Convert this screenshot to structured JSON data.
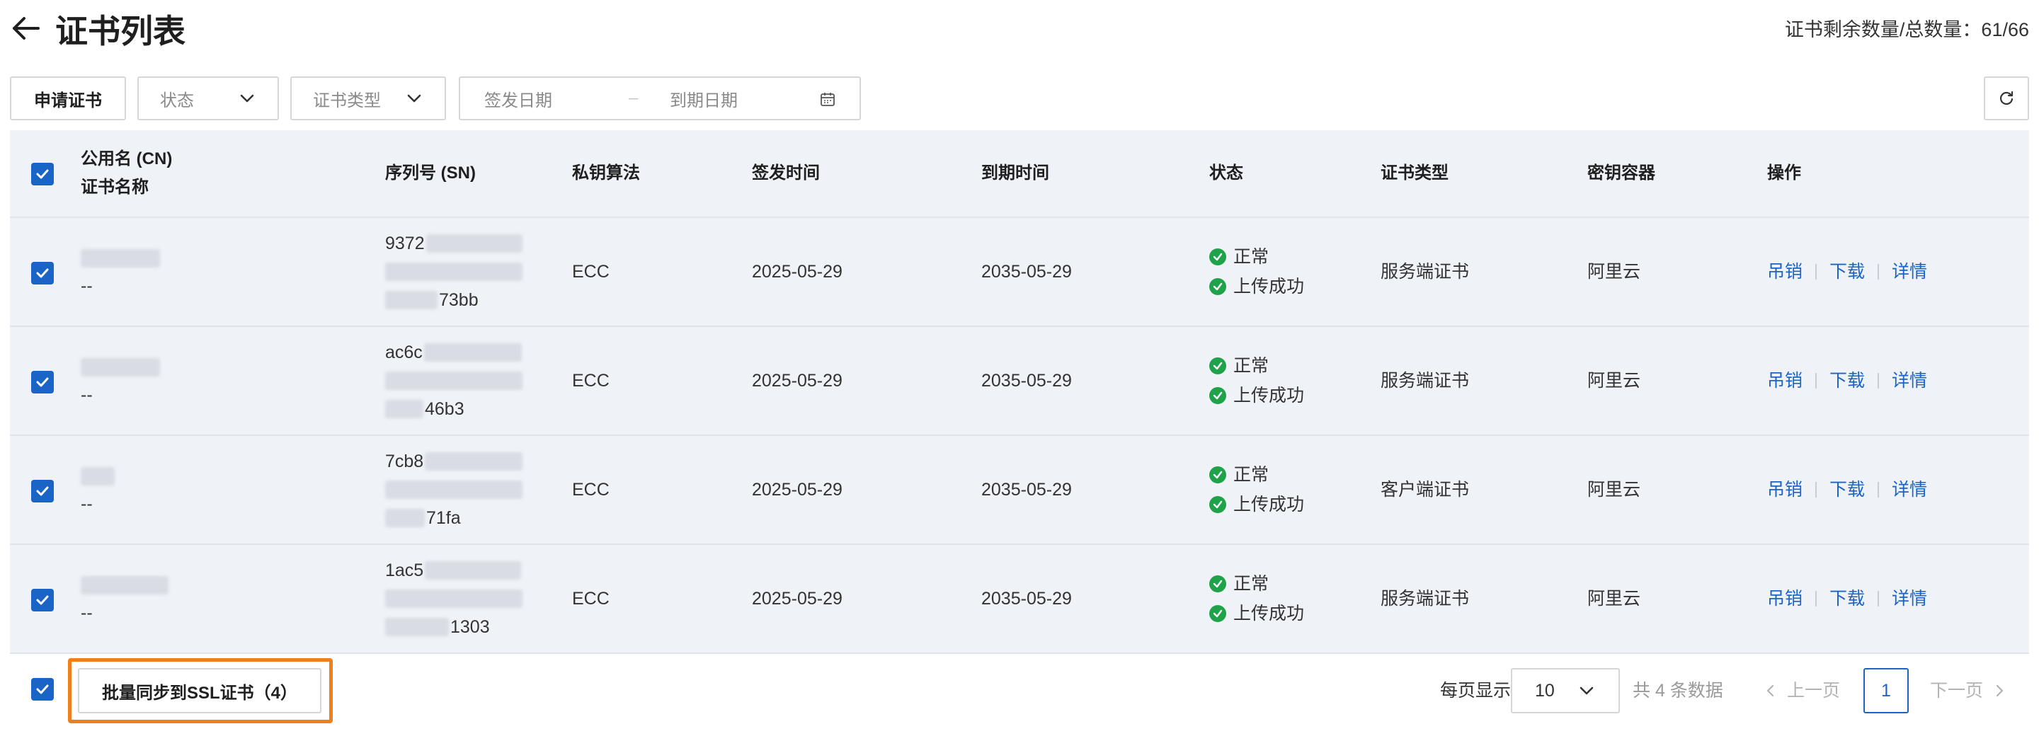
{
  "header": {
    "title": "证书列表",
    "quota_label": "证书剩余数量/总数量：",
    "quota_value": "61/66"
  },
  "toolbar": {
    "apply_label": "申请证书",
    "status_placeholder": "状态",
    "type_placeholder": "证书类型",
    "date_start_placeholder": "签发日期",
    "date_separator": "–",
    "date_end_placeholder": "到期日期"
  },
  "table": {
    "columns": {
      "cn": "公用名 (CN)",
      "cert_name": "证书名称",
      "sn": "序列号 (SN)",
      "algo": "私钥算法",
      "issue": "签发时间",
      "expire": "到期时间",
      "status": "状态",
      "type": "证书类型",
      "container": "密钥容器",
      "actions": "操作"
    },
    "rows": [
      {
        "cert_name": "--",
        "sn_start": "9372",
        "sn_end": "73bb",
        "algo": "ECC",
        "issue": "2025-05-29",
        "expire": "2035-05-29",
        "status1": "正常",
        "status2": "上传成功",
        "type": "服务端证书",
        "container": "阿里云",
        "act_revoke": "吊销",
        "act_download": "下载",
        "act_detail": "详情"
      },
      {
        "cert_name": "--",
        "sn_start": "ac6c",
        "sn_end": "46b3",
        "algo": "ECC",
        "issue": "2025-05-29",
        "expire": "2035-05-29",
        "status1": "正常",
        "status2": "上传成功",
        "type": "服务端证书",
        "container": "阿里云",
        "act_revoke": "吊销",
        "act_download": "下载",
        "act_detail": "详情"
      },
      {
        "cert_name": "--",
        "sn_start": "7cb8",
        "sn_end": "71fa",
        "algo": "ECC",
        "issue": "2025-05-29",
        "expire": "2035-05-29",
        "status1": "正常",
        "status2": "上传成功",
        "type": "客户端证书",
        "container": "阿里云",
        "act_revoke": "吊销",
        "act_download": "下载",
        "act_detail": "详情"
      },
      {
        "cert_name": "--",
        "sn_start": "1ac5",
        "sn_end": "1303",
        "algo": "ECC",
        "issue": "2025-05-29",
        "expire": "2035-05-29",
        "status1": "正常",
        "status2": "上传成功",
        "type": "服务端证书",
        "container": "阿里云",
        "act_revoke": "吊销",
        "act_download": "下载",
        "act_detail": "详情"
      }
    ]
  },
  "footer": {
    "batch_label": "批量同步到SSL证书（4）",
    "per_page_label": "每页显示",
    "page_size": "10",
    "total_text": "共 4 条数据",
    "prev_label": "上一页",
    "current_page": "1",
    "next_label": "下一页"
  },
  "colors": {
    "primary": "#1a64c8",
    "success": "#1fa34a",
    "highlight": "#f07e1b",
    "table_bg": "#eff2f7"
  }
}
